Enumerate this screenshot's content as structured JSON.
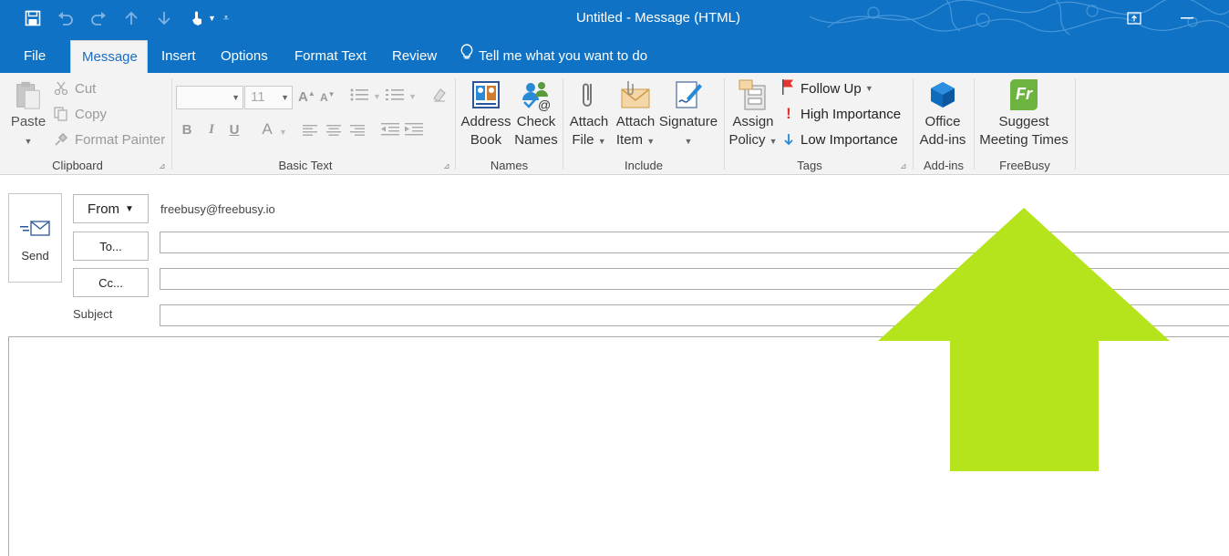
{
  "window": {
    "title": "Untitled - Message (HTML)"
  },
  "tabs": [
    {
      "label": "File"
    },
    {
      "label": "Message",
      "active": true
    },
    {
      "label": "Insert"
    },
    {
      "label": "Options"
    },
    {
      "label": "Format Text"
    },
    {
      "label": "Review"
    }
  ],
  "tell_me": "Tell me what you want to do",
  "ribbon": {
    "clipboard": {
      "paste": "Paste",
      "cut": "Cut",
      "copy": "Copy",
      "format_painter": "Format Painter",
      "group_label": "Clipboard"
    },
    "basic_text": {
      "font_size": "11",
      "bold": "B",
      "italic": "I",
      "underline": "U",
      "font_color": "A",
      "group_label": "Basic Text"
    },
    "names": {
      "address_book_l1": "Address",
      "address_book_l2": "Book",
      "check_names_l1": "Check",
      "check_names_l2": "Names",
      "group_label": "Names"
    },
    "include": {
      "attach_file_l1": "Attach",
      "attach_file_l2": "File",
      "attach_item_l1": "Attach",
      "attach_item_l2": "Item",
      "signature": "Signature",
      "group_label": "Include"
    },
    "tags": {
      "assign_policy_l1": "Assign",
      "assign_policy_l2": "Policy",
      "follow_up": "Follow Up",
      "high_importance": "High Importance",
      "low_importance": "Low Importance",
      "group_label": "Tags"
    },
    "addins": {
      "office_addins_l1": "Office",
      "office_addins_l2": "Add-ins",
      "group_label": "Add-ins"
    },
    "freebusy": {
      "suggest_l1": "Suggest",
      "suggest_l2": "Meeting Times",
      "logo_text": "Fr",
      "group_label": "FreeBusy"
    }
  },
  "compose": {
    "send": "Send",
    "from_button": "From",
    "from_address": "freebusy@freebusy.io",
    "to_button": "To...",
    "cc_button": "Cc...",
    "subject_label": "Subject",
    "to_value": "",
    "cc_value": "",
    "subject_value": "",
    "body_value": ""
  },
  "colors": {
    "title_bar": "#0f72c5",
    "ribbon_bg": "#f3f3f3",
    "arrow": "#b5e41d",
    "freebusy_logo": "#6cb33f",
    "office_blue": "#0f6cbd",
    "flag_red": "#e3342f"
  }
}
